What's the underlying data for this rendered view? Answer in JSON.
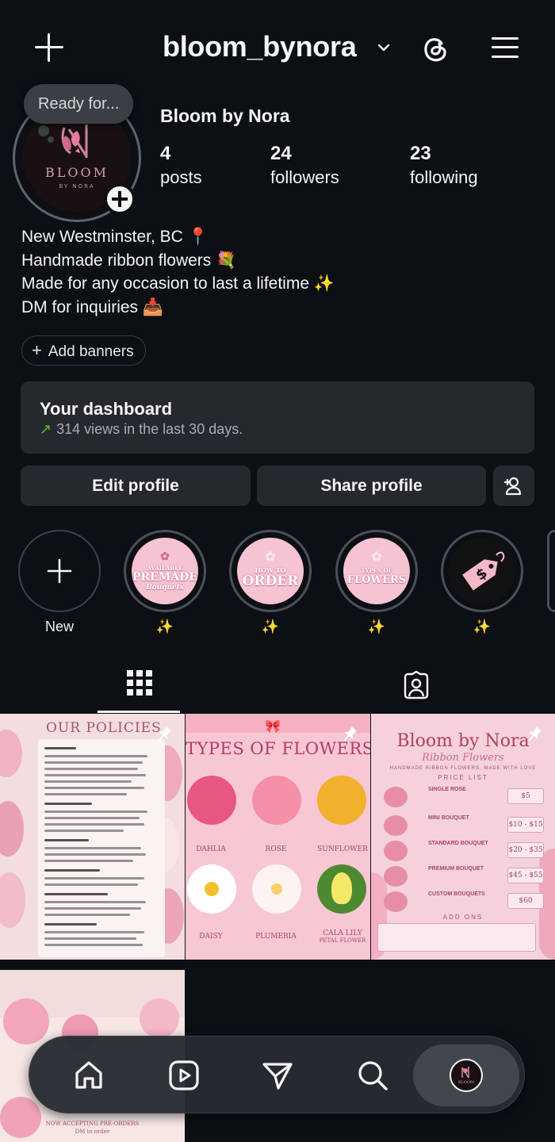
{
  "header": {
    "username": "bloom_bynora",
    "new_post_icon": "plus-icon",
    "switch_account_icon": "chevron-down-icon",
    "threads_icon": "threads-icon",
    "menu_icon": "hamburger-menu-icon"
  },
  "profile": {
    "note": "Ready for...",
    "avatar_brand": "BLOOM",
    "avatar_sub": "BY NORA",
    "display_name": "Bloom by Nora",
    "stats": [
      {
        "value": "4",
        "label": "posts"
      },
      {
        "value": "24",
        "label": "followers"
      },
      {
        "value": "23",
        "label": "following"
      }
    ],
    "bio": [
      "New Westminster, BC 📍",
      "Handmade ribbon flowers 💐",
      "Made for any occasion to last a lifetime ✨",
      "DM for inquiries 📥"
    ],
    "add_banners": "Add banners"
  },
  "dashboard": {
    "title": "Your dashboard",
    "arrow": "↗",
    "subtitle": "314 views in the last 30 days."
  },
  "actions": {
    "edit": "Edit profile",
    "share": "Share profile",
    "add_user_icon": "add-person-icon"
  },
  "highlights": [
    {
      "label": "New"
    },
    {
      "label": "✨",
      "line1": "AVAILABLE",
      "line2": "PREMADE",
      "line3": "Bouquets"
    },
    {
      "label": "✨",
      "line1": "HOW TO",
      "line2": "ORDER"
    },
    {
      "label": "✨",
      "line1": "TYPES OF",
      "line2": "FLOWERS"
    },
    {
      "label": "✨"
    }
  ],
  "tabs": {
    "grid_icon": "grid-icon",
    "tagged_icon": "tagged-person-icon"
  },
  "posts": {
    "policies": {
      "title": "OUR POLICIES"
    },
    "types": {
      "title": "TYPES OF FLOWERS",
      "flowers": [
        "DAHLIA",
        "ROSE",
        "SUNFLOWER",
        "DAISY",
        "PLUMERIA",
        "CALA LILY"
      ],
      "flower_note": "PETAL FLOWER"
    },
    "prices": {
      "title": "Bloom by Nora",
      "subtitle": "Ribbon Flowers",
      "tagline": "HANDMADE RIBBON FLOWERS, MADE WITH LOVE",
      "heading": "PRICE LIST",
      "items": [
        {
          "name": "SINGLE ROSE",
          "price": "$5"
        },
        {
          "name": "MINI BOUQUET",
          "price": "$10 - $15"
        },
        {
          "name": "STANDARD BOUQUET",
          "price": "$20 - $35"
        },
        {
          "name": "PREMIUM BOUQUET",
          "price": "$45 - $55"
        },
        {
          "name": "CUSTOM BOUQUETS",
          "price": "$60"
        }
      ],
      "addons": "ADD ONS"
    },
    "preorder": {
      "line1": "NOW ACCEPTING PRE-ORDERS",
      "line2": "DM to order"
    }
  },
  "nav": {
    "items": [
      "home-icon",
      "reels-icon",
      "direct-message-icon",
      "search-icon",
      "profile-avatar"
    ]
  }
}
